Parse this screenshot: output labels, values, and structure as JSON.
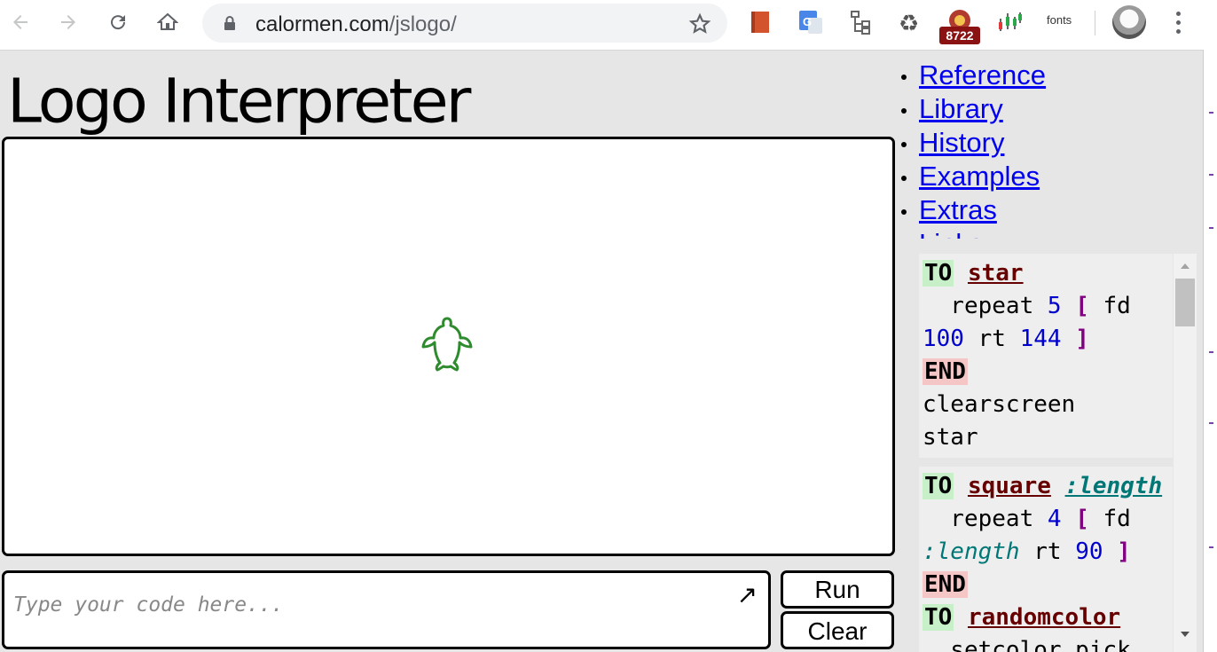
{
  "browser": {
    "url_host": "calormen.com",
    "url_path": "/jslogo/",
    "extension_badge": "8722",
    "fonts_extension_label": "fonts"
  },
  "page": {
    "title": "Logo Interpreter"
  },
  "nav_links": [
    {
      "label": "Reference"
    },
    {
      "label": "Library"
    },
    {
      "label": "History"
    },
    {
      "label": "Examples"
    },
    {
      "label": "Extras"
    },
    {
      "label": "Links"
    }
  ],
  "input": {
    "placeholder": "Type your code here...",
    "expand_glyph": "↗"
  },
  "buttons": {
    "run": "Run",
    "clear": "Clear"
  },
  "examples": {
    "star": {
      "to": "TO",
      "name": "star",
      "body_1": "  repeat ",
      "num_5": "5",
      "open": "[",
      "fd": " fd",
      "num_100": "100",
      "rt": " rt ",
      "num_144": "144",
      "close": "]",
      "end": "END",
      "line_cs": "clearscreen",
      "line_star": "star"
    },
    "square": {
      "to": "TO",
      "name": "square",
      "param": ":length",
      "body_1": "  repeat ",
      "num_4": "4",
      "open": "[",
      "fd": " fd",
      "var": ":length",
      "rt": " rt ",
      "num_90": "90",
      "close": "]",
      "end": "END"
    },
    "randomcolor": {
      "to": "TO",
      "name": "randomcolor",
      "body_partial": "  setcolor pick"
    }
  },
  "colors": {
    "link": "#0000ee",
    "turtle": "#2e8b2e",
    "keyword_to_bg": "#c8f0c8",
    "keyword_end_bg": "#f4c6c6"
  }
}
